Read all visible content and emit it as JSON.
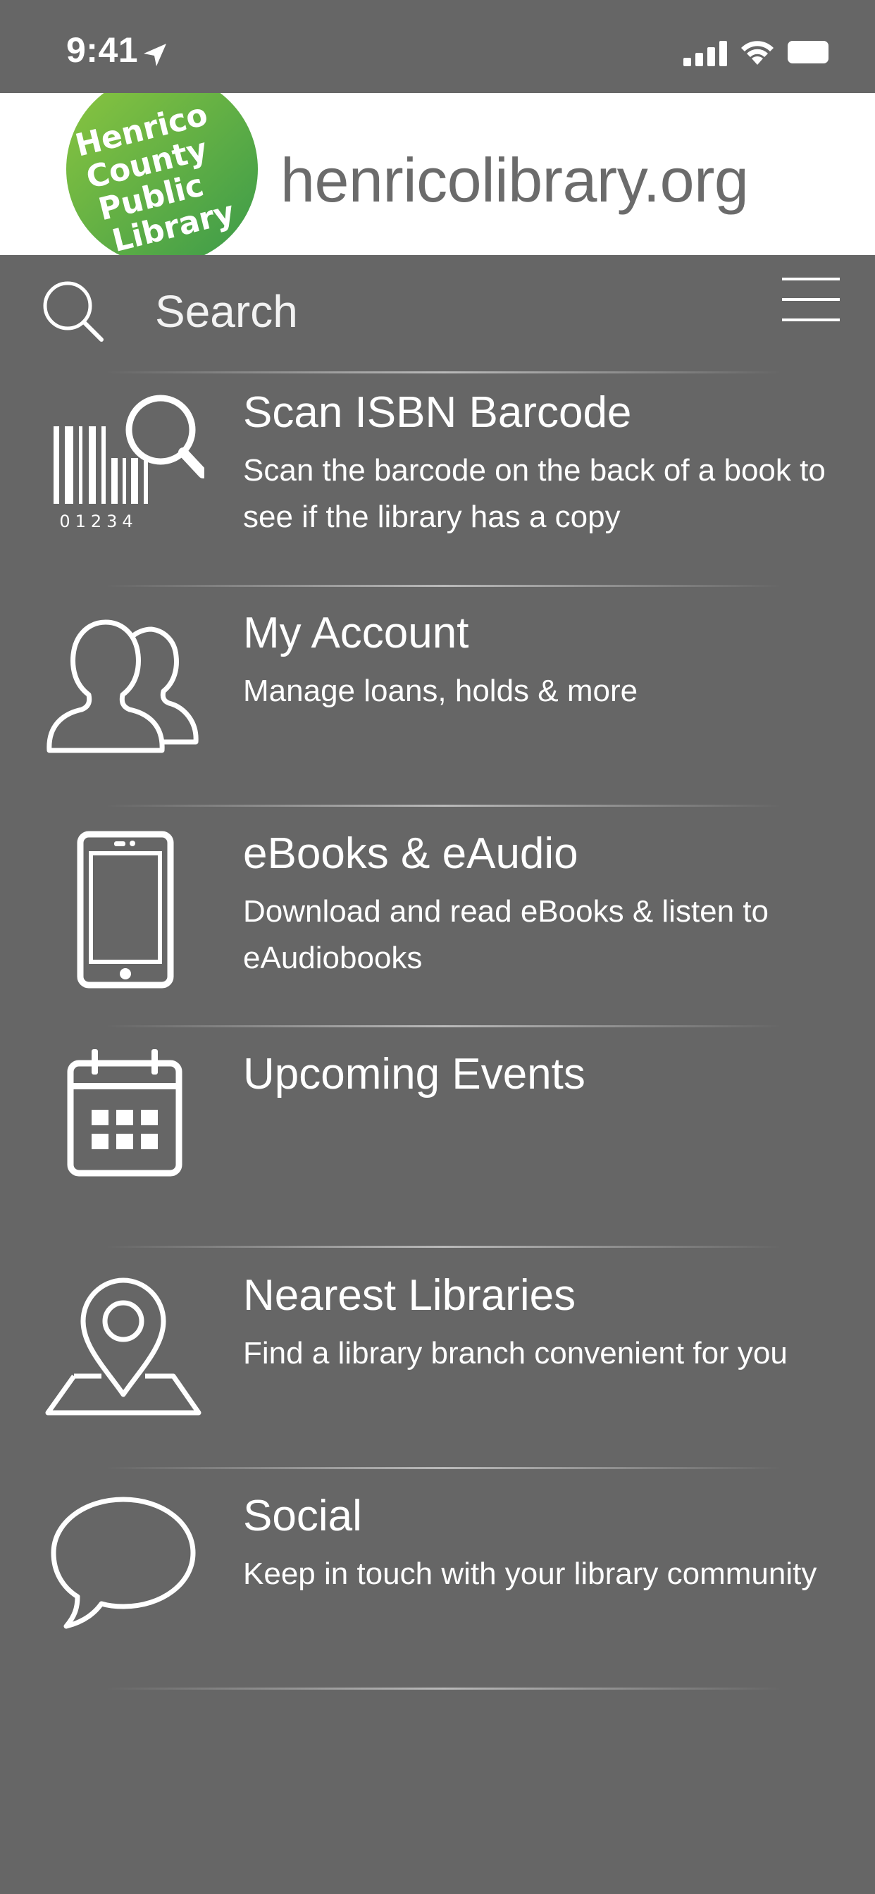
{
  "status_bar": {
    "time": "9:41",
    "icons": [
      "location-arrow-icon",
      "signal-icon",
      "wifi-icon",
      "battery-icon"
    ]
  },
  "header": {
    "logo_text": "Henrico County Public Library",
    "logo_lines": [
      "Henrico",
      "County",
      "Public",
      "Library"
    ],
    "site_url": "henricolibrary.org"
  },
  "search": {
    "placeholder": "Search",
    "value": ""
  },
  "menu": {
    "items": [
      {
        "icon": "barcode-scan-icon",
        "title": "Scan ISBN Barcode",
        "description": "Scan the barcode on the back of a book to see if the library has a copy",
        "barcode_digits": "01234"
      },
      {
        "icon": "users-icon",
        "title": "My Account",
        "description": "Manage loans, holds & more"
      },
      {
        "icon": "phone-icon",
        "title": "eBooks & eAudio",
        "description": "Download and read eBooks & listen to eAudiobooks"
      },
      {
        "icon": "calendar-icon",
        "title": "Upcoming Events",
        "description": ""
      },
      {
        "icon": "map-pin-icon",
        "title": "Nearest Libraries",
        "description": "Find a library branch convenient for you"
      },
      {
        "icon": "chat-bubble-icon",
        "title": "Social",
        "description": "Keep in touch with your library community"
      }
    ]
  },
  "colors": {
    "background": "#666666",
    "header_background": "#ffffff",
    "logo_green_light": "#8cc63f",
    "logo_green_dark": "#3a9a4a",
    "url_text": "#6b6b6b",
    "text": "#ffffff"
  }
}
